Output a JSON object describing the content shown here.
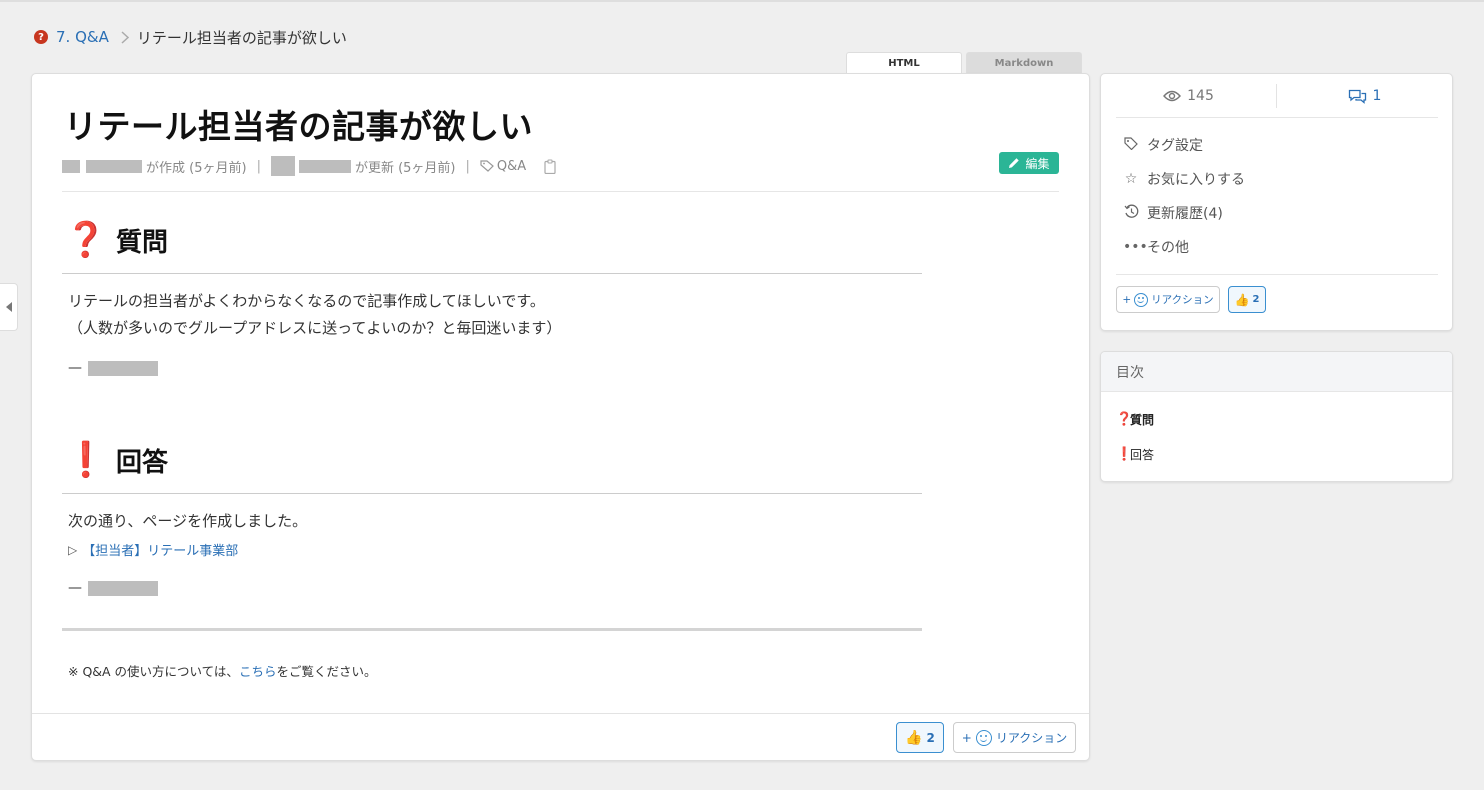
{
  "breadcrumb": {
    "icon": "question-circle-icon",
    "parent": "7. Q&A",
    "current": "リテール担当者の記事が欲しい"
  },
  "tabs": {
    "html": "HTML",
    "markdown": "Markdown"
  },
  "article": {
    "title": "リテール担当者の記事が欲しい",
    "meta": {
      "created": "が作成 (5ヶ月前)",
      "updated": "が更新 (5ヶ月前)",
      "separator": "|",
      "tag": "Q&A"
    },
    "edit_label": "編集",
    "question": {
      "mark": "❓",
      "heading": "質問",
      "line1": "リテールの担当者がよくわからなくなるので記事作成してほしいです。",
      "line2": "（人数が多いのでグループアドレスに送ってよいのか？と毎回迷います）",
      "dash": "—"
    },
    "answer": {
      "mark": "❗",
      "heading": "回答",
      "line1": "次の通り、ページを作成しました。",
      "link_arrow": "▷",
      "link": "【担当者】リテール事業部",
      "dash": "—"
    },
    "note_prefix": "※ Q&A の使い方については、",
    "note_link": "こちら",
    "note_suffix": "をご覧ください。"
  },
  "footer": {
    "like_count": "2",
    "reaction_label": "リアクション",
    "plus": "+"
  },
  "sidebar": {
    "views": "145",
    "comments": "1",
    "menu": [
      {
        "icon": "tag-icon",
        "label": "タグ設定"
      },
      {
        "icon": "star-icon",
        "label": "お気に入りする"
      },
      {
        "icon": "history-icon",
        "label": "更新履歴(4)"
      },
      {
        "icon": "more-icon",
        "label": "その他"
      }
    ],
    "reaction_label": "リアクション",
    "like_count": "2",
    "plus": "+"
  },
  "toc": {
    "title": "目次",
    "items": [
      {
        "mark": "❓",
        "label": "質問"
      },
      {
        "mark": "❗",
        "label": "回答"
      }
    ]
  },
  "colors": {
    "accent": "#2a6fb5",
    "edit_button": "#2bb596",
    "mark_red": "#d0201a",
    "background": "#efefef"
  }
}
